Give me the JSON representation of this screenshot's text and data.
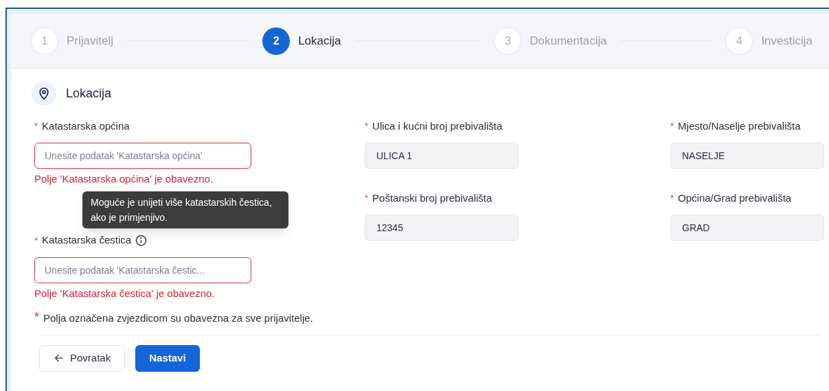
{
  "steps": [
    {
      "number": "1",
      "label": "Prijavitelj",
      "selected": false
    },
    {
      "number": "2",
      "label": "Lokacija",
      "selected": true
    },
    {
      "number": "3",
      "label": "Dokumentacija",
      "selected": false
    },
    {
      "number": "4",
      "label": "Investicija",
      "selected": false
    }
  ],
  "section": {
    "title": "Lokacija"
  },
  "fields": [
    {
      "label": "Katastarska općina",
      "required": true,
      "info": false,
      "placeholder": "Unesite podatak 'Katastarska općina'",
      "error": "Polje 'Katastarska općina' je obavezno."
    },
    {
      "label": "Ulica i kućni broj prebivališta",
      "required": true,
      "info": false,
      "value": "ULICA 1"
    },
    {
      "label": "Mjesto/Naselje prebivališta",
      "required": true,
      "info": false,
      "value": "NASELJE"
    },
    {
      "label": "Katastarska čestica",
      "required": true,
      "info": true,
      "placeholder": "Unesite podatak 'Katastarska čestic...",
      "error": "Polje 'Katastarska čestica' je obavezno."
    },
    {
      "label": "Poštanski broj prebivališta",
      "required": true,
      "info": false,
      "value": "12345"
    },
    {
      "label": "Općina/Grad prebivališta",
      "required": true,
      "info": false,
      "value": "GRAD"
    }
  ],
  "tooltip": "Moguće je unijeti više katastarskih čestica, ako je primjenjivo.",
  "required_note": {
    "mark": "*",
    "text": "Polja označena zvjezdicom su obavezna za sve prijavitelje."
  },
  "buttons": {
    "back": "Povratak",
    "next": "Nastavi"
  }
}
